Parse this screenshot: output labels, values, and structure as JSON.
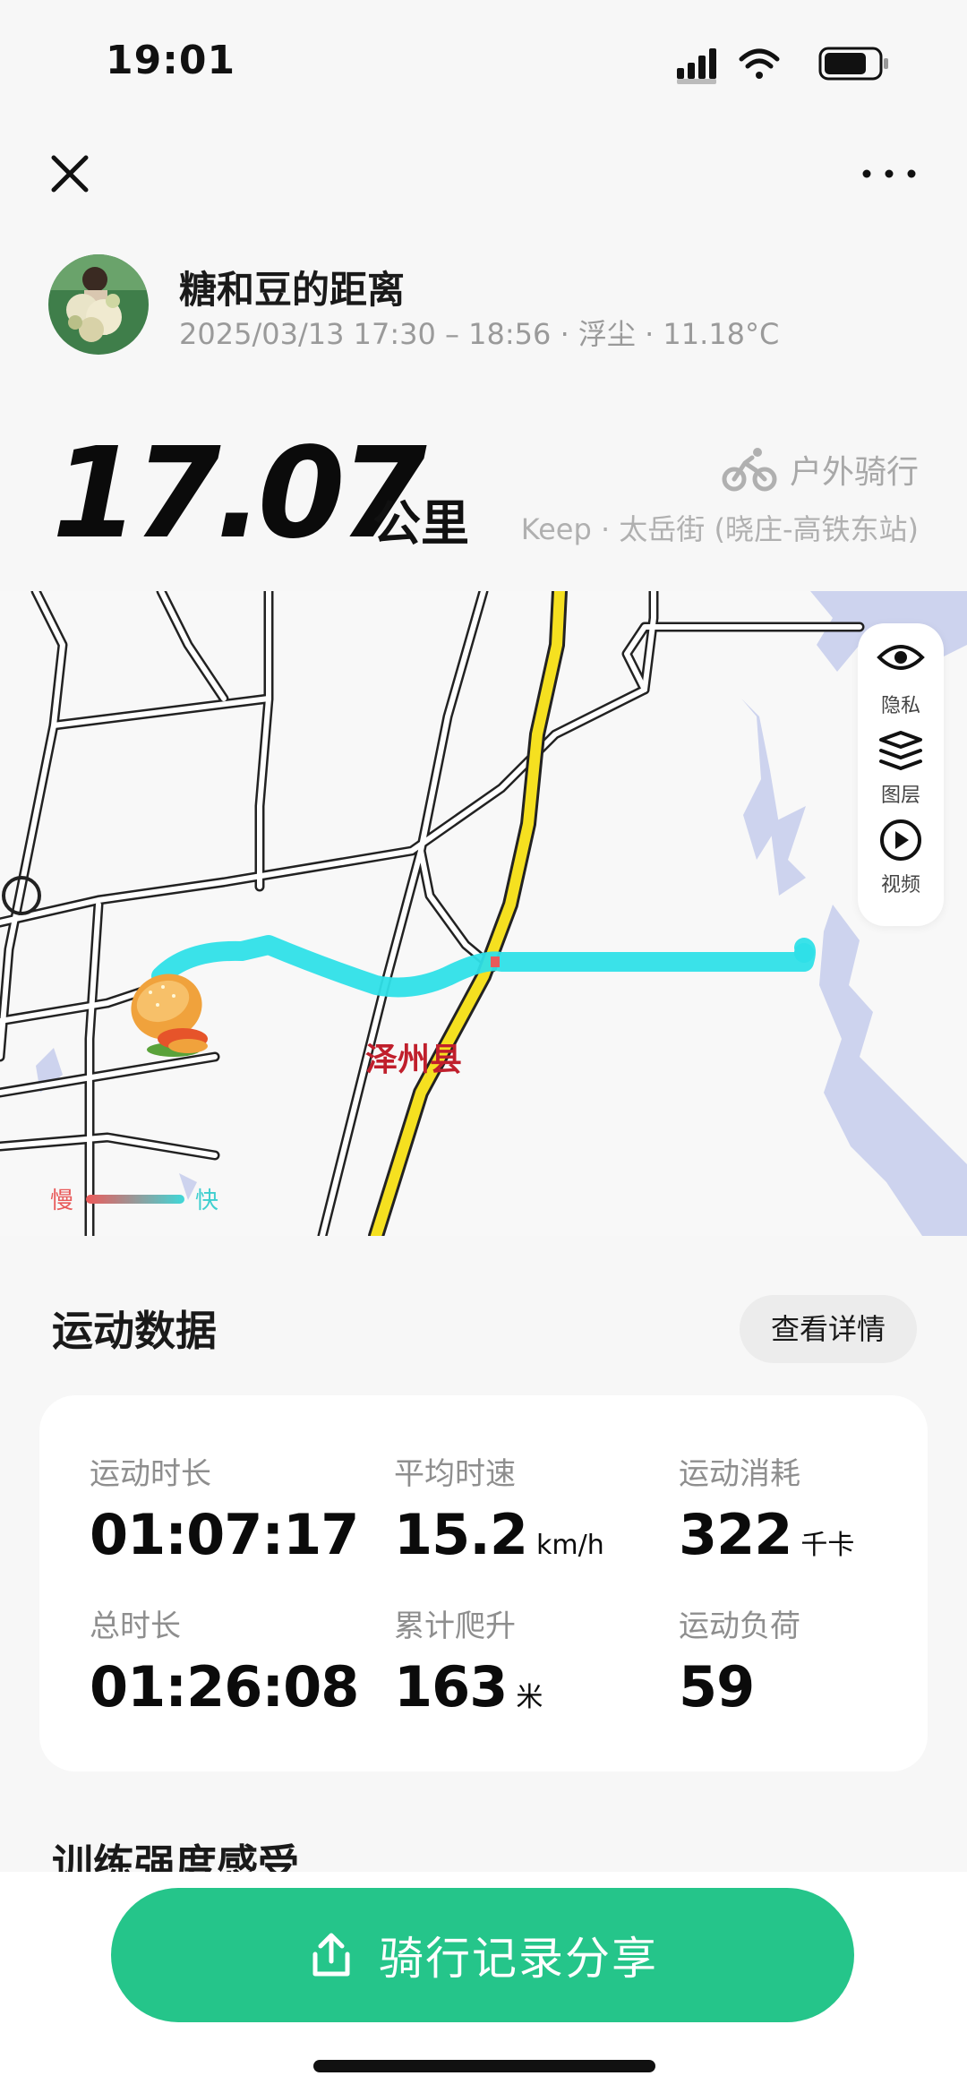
{
  "status_bar": {
    "time": "19:01"
  },
  "user": {
    "name": "糖和豆的距离",
    "meta": "2025/03/13 17:30 – 18:56 · 浮尘 · 11.18°C"
  },
  "summary": {
    "distance": "17.07",
    "unit": "公里",
    "sport_type": "户外骑行",
    "route": "Keep · 太岳街 (晓庄-高铁东站)"
  },
  "map": {
    "county_label": "泽州县",
    "tools": {
      "privacy": "隐私",
      "layers": "图层",
      "video": "视频"
    },
    "legend": {
      "slow": "慢",
      "fast": "快"
    },
    "colors": {
      "route": "#2fe0e8",
      "highway": "#f5e020",
      "water": "#cdd3ee"
    }
  },
  "stats": {
    "title": "运动数据",
    "detail_button": "查看详情",
    "items": [
      {
        "label": "运动时长",
        "value": "01:07:17",
        "unit": ""
      },
      {
        "label": "平均时速",
        "value": "15.2",
        "unit": "km/h"
      },
      {
        "label": "运动消耗",
        "value": "322",
        "unit": "千卡"
      },
      {
        "label": "总时长",
        "value": "01:26:08",
        "unit": ""
      },
      {
        "label": "累计爬升",
        "value": "163",
        "unit": "米"
      },
      {
        "label": "运动负荷",
        "value": "59",
        "unit": ""
      }
    ]
  },
  "training": {
    "title": "训练强度感受"
  },
  "share": {
    "label": "骑行记录分享",
    "color": "#25c58a"
  }
}
